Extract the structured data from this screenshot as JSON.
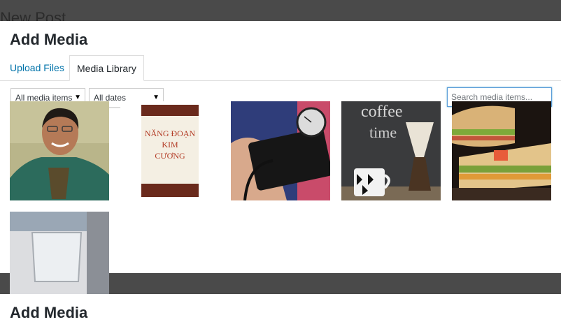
{
  "background": {
    "page_title": "New Post"
  },
  "modal": {
    "title": "Add Media",
    "tabs": [
      {
        "label": "Upload Files",
        "active": false
      },
      {
        "label": "Media Library",
        "active": true
      }
    ],
    "filters": {
      "type_selected": "All media items",
      "date_selected": "All dates"
    },
    "search": {
      "placeholder": "Search media items...",
      "value": ""
    },
    "attachments": [
      {
        "name": "portrait-man-green-shirt"
      },
      {
        "name": "book-cover-nang-doan-kim-cuong",
        "text": [
          "NĂNG ĐOẠN",
          "KIM",
          "CƯƠNG"
        ]
      },
      {
        "name": "blood-pressure-gauge"
      },
      {
        "name": "coffee-chalkboard-chemex",
        "text": [
          "coffee",
          "time"
        ]
      },
      {
        "name": "sandwich"
      },
      {
        "name": "glass-cup"
      }
    ]
  },
  "lower_modal": {
    "title": "Add Media"
  },
  "colors": {
    "link": "#0073aa",
    "overlay": "#4a4a4a",
    "focus": "#5b9dd9"
  }
}
